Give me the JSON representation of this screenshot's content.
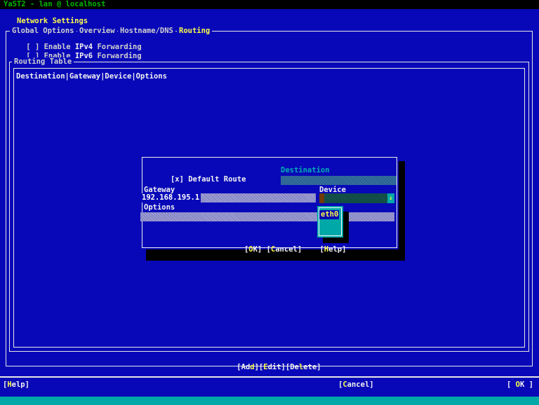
{
  "titlebar": {
    "text": "YaST2 - lan @ localhost"
  },
  "page": {
    "title": "Network Settings"
  },
  "tabs": {
    "items": [
      {
        "label": "Global Options"
      },
      {
        "label": "Overview"
      },
      {
        "label": "Hostname/DNS"
      },
      {
        "label": "Routing"
      }
    ],
    "active": "Routing"
  },
  "forwarding": {
    "ipv4": {
      "box": "[ ]",
      "pre": " Enable ",
      "hot": "IPv4",
      "post": " Forwarding"
    },
    "ipv6": {
      "box": "[ ]",
      "pre": " Enable ",
      "hot": "IPv6",
      "post": " Forwarding"
    }
  },
  "routing_table": {
    "frame_label": "Routing Table",
    "header": "Destination|Gateway|Device|Options"
  },
  "dialog": {
    "default_route": {
      "box": "[x]",
      "label": " Default Route"
    },
    "destination": {
      "label": "Destination",
      "value": ""
    },
    "gateway": {
      "label": "Gateway",
      "value": "192.168.195.1"
    },
    "device": {
      "label": "Device",
      "value": "",
      "arrow": "↓",
      "dropdown": {
        "selected": "eth0"
      }
    },
    "options": {
      "label": "Options",
      "value": ""
    },
    "buttons": {
      "ok": {
        "pre": "[",
        "hot": "O",
        "post": "K]"
      },
      "cancel": {
        "pre": "[",
        "hot": "C",
        "post": "ancel]"
      },
      "help": {
        "pre": "[",
        "hot": "H",
        "post": "elp]"
      }
    }
  },
  "table_buttons": {
    "add": {
      "pre": "[Ad",
      "hot": "d",
      "post": "]"
    },
    "edit": {
      "pre": "[",
      "hot": "E",
      "post": "dit]"
    },
    "delete": {
      "pre": "[De",
      "hot": "l",
      "post": "ete]"
    }
  },
  "bottom_bar": {
    "help": {
      "pre": "[",
      "hot": "H",
      "post": "elp]"
    },
    "cancel": {
      "pre": "[",
      "hot": "C",
      "post": "ancel]"
    },
    "ok": {
      "pre": "[ ",
      "hot": "O",
      "post": "K ]"
    }
  },
  "colors": {
    "background": "#0808b8",
    "titlebar_bg": "#000000",
    "titlebar_text": "#00b800",
    "accent_yellow": "#fcfc4c",
    "frame_white": "#e8e8e8",
    "field_lavender": "#9c9cd2",
    "field_focus_blue": "#35709d",
    "combo_teal_dark": "#14564f",
    "popup_teal": "#00a8a8",
    "bottom_strip_teal": "#00a8a8",
    "focused_label_cyan": "#00b2b2"
  }
}
